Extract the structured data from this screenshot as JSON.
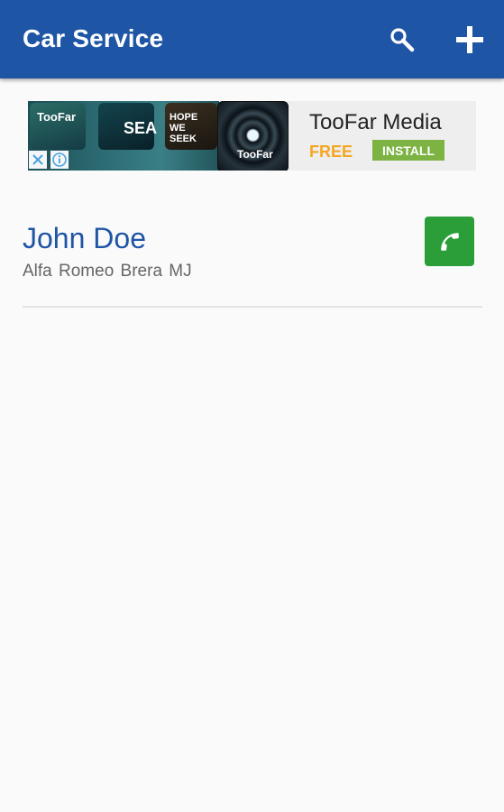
{
  "app_bar": {
    "title": "Car Service",
    "actions": [
      {
        "name": "search",
        "icon": "search-icon"
      },
      {
        "name": "add",
        "icon": "plus-icon"
      }
    ],
    "color": "#1f55a5"
  },
  "ad": {
    "banner_tiles": [
      "TooFar",
      "SEA",
      "HOPE WE SEEK"
    ],
    "logo_text": "TooFar",
    "title": "TooFar Media",
    "price": "FREE",
    "install_label": "INSTALL",
    "close_glyph": "✕",
    "info_glyph": "ⓘ"
  },
  "contacts": [
    {
      "name": "John Doe",
      "car": "Alfa Romeo Brera MJ",
      "call_icon": "phone-icon",
      "call_color": "#2b9e3a"
    }
  ]
}
